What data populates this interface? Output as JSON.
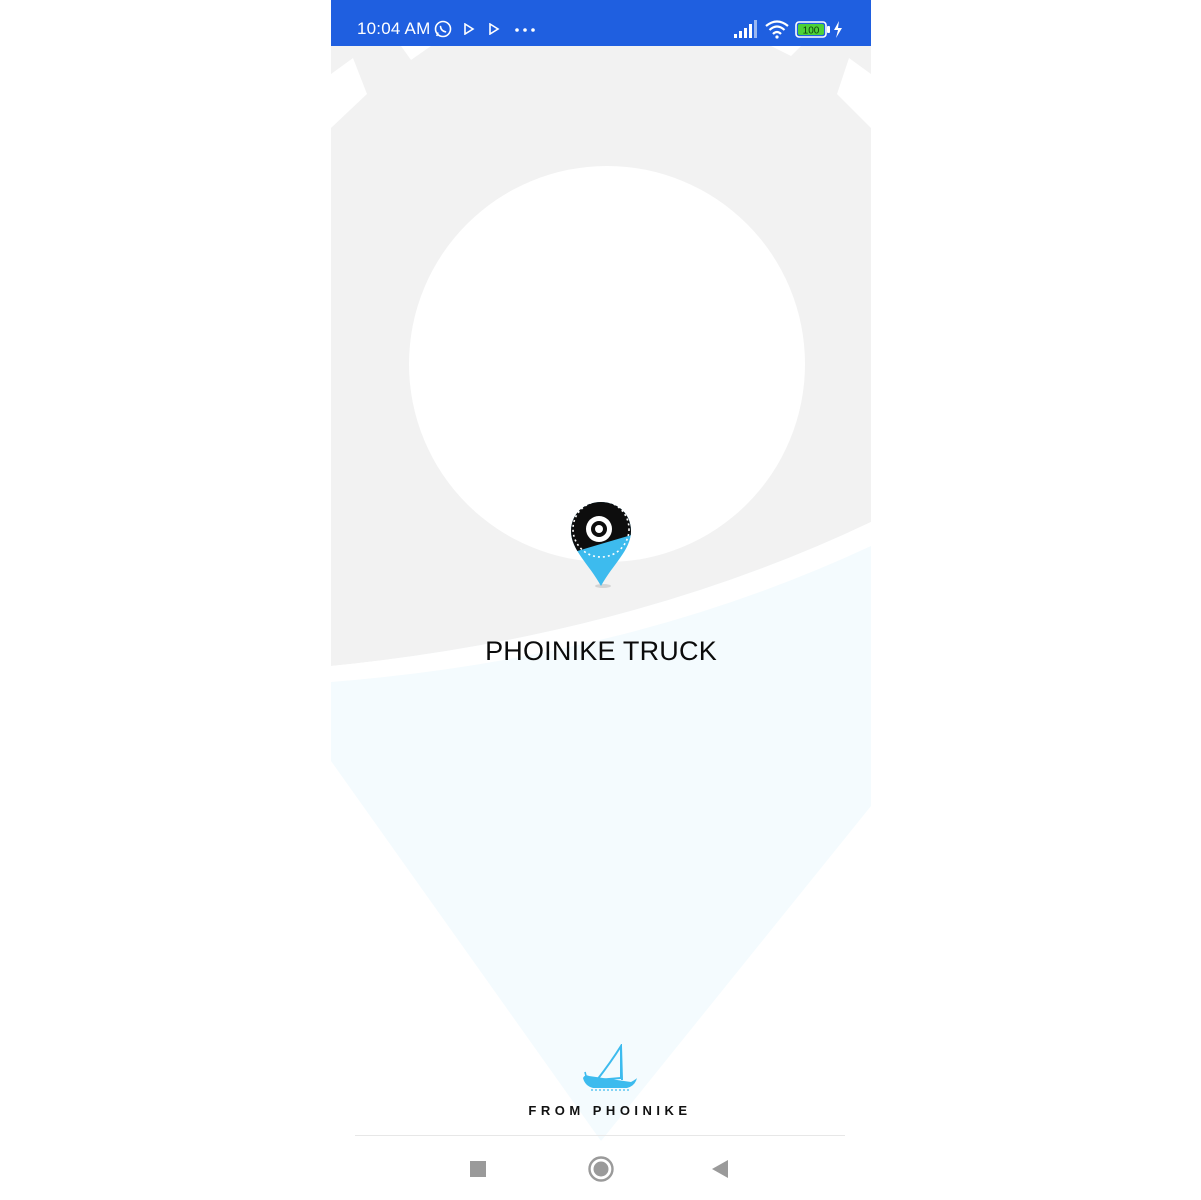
{
  "status_bar": {
    "time": "10:04 AM",
    "battery": "100",
    "icons": [
      "whatsapp-icon",
      "play-icon",
      "play-icon",
      "more-dots-icon",
      "signal-icon",
      "wifi-icon",
      "battery-icon",
      "charging-bolt-icon"
    ]
  },
  "splash": {
    "app_name": "PHOINIKE TRUCK",
    "footer_text": "FROM PHOINIKE"
  },
  "nav_bar": {
    "buttons": [
      "recents-square-icon",
      "home-circle-icon",
      "back-triangle-icon"
    ]
  },
  "colors": {
    "status_bar": "#1f5fe0",
    "pin_blue": "#3dbbee",
    "background_gray": "#f2f2f2",
    "background_tint": "#f4fbfe"
  }
}
